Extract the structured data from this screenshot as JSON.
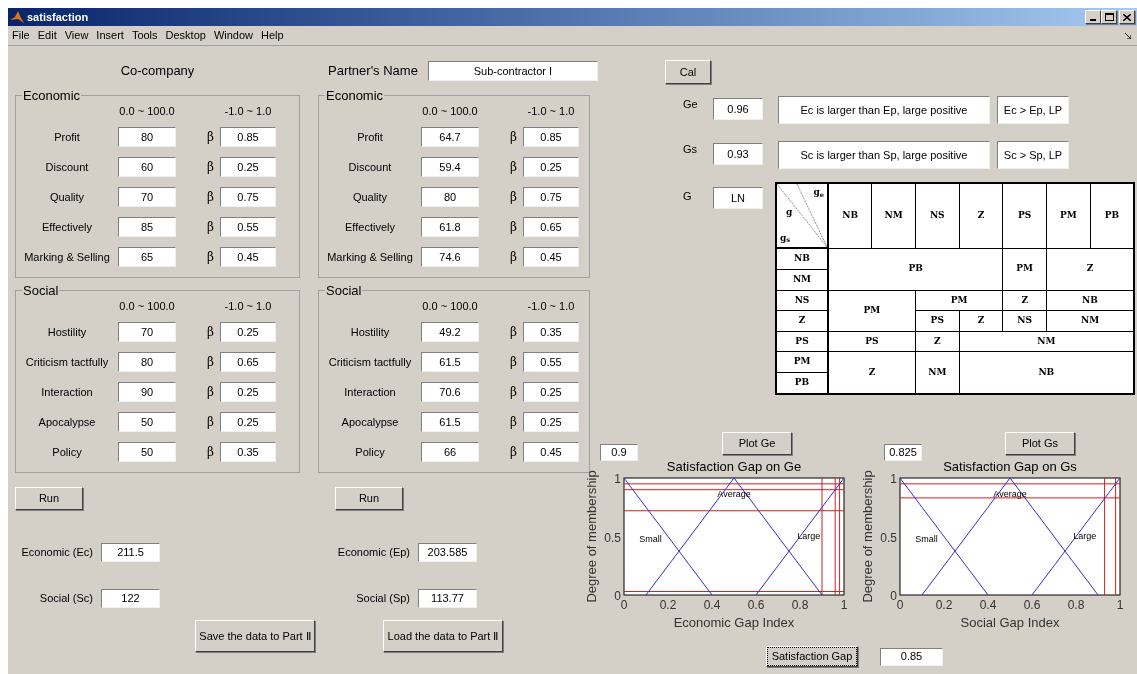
{
  "window": {
    "title": "satisfaction"
  },
  "menu": [
    "File",
    "Edit",
    "View",
    "Insert",
    "Tools",
    "Desktop",
    "Window",
    "Help"
  ],
  "companies": [
    {
      "kind": "heading",
      "title": "Co-company",
      "panels": [
        {
          "title": "Economic",
          "range_label": "0.0 ~ 100.0",
          "beta_range_label": "-1.0 ~ 1.0",
          "rows": [
            {
              "label": "Profit",
              "value": "80",
              "beta_symbol": "β",
              "beta": "0.85"
            },
            {
              "label": "Discount",
              "value": "60",
              "beta_symbol": "β",
              "beta": "0.25"
            },
            {
              "label": "Quality",
              "value": "70",
              "beta_symbol": "β",
              "beta": "0.75"
            },
            {
              "label": "Effectively",
              "value": "85",
              "beta_symbol": "β",
              "beta": "0.55"
            },
            {
              "label": "Marking & Selling",
              "value": "65",
              "beta_symbol": "β",
              "beta": "0.45"
            }
          ]
        },
        {
          "title": "Social",
          "range_label": "0.0 ~ 100.0",
          "beta_range_label": "-1.0 ~ 1.0",
          "rows": [
            {
              "label": "Hostility",
              "value": "70",
              "beta_symbol": "β",
              "beta": "0.25"
            },
            {
              "label": "Criticism tactfully",
              "value": "80",
              "beta_symbol": "β",
              "beta": "0.65"
            },
            {
              "label": "Interaction",
              "value": "90",
              "beta_symbol": "β",
              "beta": "0.25"
            },
            {
              "label": "Apocalypse",
              "value": "50",
              "beta_symbol": "β",
              "beta": "0.25"
            },
            {
              "label": "Policy",
              "value": "50",
              "beta_symbol": "β",
              "beta": "0.35"
            }
          ]
        }
      ],
      "run_button": "Run",
      "totals": [
        {
          "label": "Economic (Ec)",
          "value": "211.5"
        },
        {
          "label": "Social (Sc)",
          "value": "122"
        }
      ],
      "transfer_button": "Save the data to Part Ⅱ"
    },
    {
      "kind": "named",
      "label": "Partner's Name",
      "value": "Sub-contractor I",
      "panels": [
        {
          "title": "Economic",
          "range_label": "0.0 ~ 100.0",
          "beta_range_label": "-1.0 ~ 1.0",
          "rows": [
            {
              "label": "Profit",
              "value": "64.7",
              "beta_symbol": "β",
              "beta": "0.85"
            },
            {
              "label": "Discount",
              "value": "59.4",
              "beta_symbol": "β",
              "beta": "0.25"
            },
            {
              "label": "Quality",
              "value": "80",
              "beta_symbol": "β",
              "beta": "0.75"
            },
            {
              "label": "Effectively",
              "value": "61.8",
              "beta_symbol": "β",
              "beta": "0.65"
            },
            {
              "label": "Marking & Selling",
              "value": "74.6",
              "beta_symbol": "β",
              "beta": "0.45"
            }
          ]
        },
        {
          "title": "Social",
          "range_label": "0.0 ~ 100.0",
          "beta_range_label": "-1.0 ~ 1.0",
          "rows": [
            {
              "label": "Hostility",
              "value": "49.2",
              "beta_symbol": "β",
              "beta": "0.35"
            },
            {
              "label": "Criticism tactfully",
              "value": "61.5",
              "beta_symbol": "β",
              "beta": "0.55"
            },
            {
              "label": "Interaction",
              "value": "70.6",
              "beta_symbol": "β",
              "beta": "0.25"
            },
            {
              "label": "Apocalypse",
              "value": "61.5",
              "beta_symbol": "β",
              "beta": "0.25"
            },
            {
              "label": "Policy",
              "value": "66",
              "beta_symbol": "β",
              "beta": "0.45"
            }
          ]
        }
      ],
      "run_button": "Run",
      "totals": [
        {
          "label": "Economic (Ep)",
          "value": "203.585"
        },
        {
          "label": "Social (Sp)",
          "value": "113.77"
        }
      ],
      "transfer_button": "Load the data to Part Ⅱ"
    }
  ],
  "calculate_button": "Cal",
  "gaps": [
    {
      "label": "Ge",
      "value": "0.96",
      "description": "Ec is larger than Ep, large positive",
      "code": "Ec > Ep, LP"
    },
    {
      "label": "Gs",
      "value": "0.93",
      "description": "Sc is larger than Sp, large positive",
      "code": "Sc > Sp, LP"
    }
  ],
  "overall": {
    "label": "G",
    "value": "LN"
  },
  "rule_table": {
    "corner": {
      "top": "g$_{e}$",
      "middle": "g",
      "bottom": "g$_{s}$"
    },
    "columns": [
      "NB",
      "NM",
      "NS",
      "Z",
      "PS",
      "PM",
      "PB"
    ],
    "rows": [
      {
        "header": "NB",
        "cells": [
          {
            "text": "PB",
            "colspan": 4,
            "rowspan": 2
          },
          {
            "text": "PM",
            "rowspan": 2
          },
          {
            "text": "Z",
            "colspan": 2,
            "rowspan": 2
          }
        ]
      },
      {
        "header": "NM",
        "cells": []
      },
      {
        "header": "NS",
        "cells": [
          {
            "text": "PM",
            "colspan": 2,
            "rowspan": 2
          },
          {
            "text": "PM",
            "colspan": 2
          },
          {
            "text": "Z"
          },
          {
            "text": "NB",
            "colspan": 2
          }
        ]
      },
      {
        "header": "Z",
        "cells": [
          {
            "text": "PS"
          },
          {
            "text": "Z"
          },
          {
            "text": "NS"
          },
          {
            "text": "NM",
            "colspan": 2
          }
        ]
      },
      {
        "header": "PS",
        "cells": [
          {
            "text": "PS",
            "colspan": 2
          },
          {
            "text": "Z"
          },
          {
            "text": "NM",
            "colspan": 4
          }
        ]
      },
      {
        "header": "PM",
        "cells": [
          {
            "text": "Z",
            "colspan": 2,
            "rowspan": 2
          },
          {
            "text": "NM",
            "rowspan": 2
          },
          {
            "text": "NB",
            "colspan": 4,
            "rowspan": 2
          }
        ]
      },
      {
        "header": "PB",
        "cells": []
      }
    ]
  },
  "plots": [
    {
      "value": "0.9",
      "button": "Plot Ge",
      "chart_data": {
        "type": "line",
        "title": "Satisfaction Gap on Ge",
        "xlabel": "Economic Gap Index",
        "ylabel": "Degree of membership",
        "x": [
          0,
          0.1,
          0.4,
          0.5,
          0.6,
          0.9,
          1
        ],
        "series": [
          {
            "name": "Small",
            "color": "#3030c0",
            "values": [
              1,
              0.75,
              0,
              null,
              null,
              null,
              null
            ]
          },
          {
            "name": "Average",
            "color": "#3030c0",
            "values": [
              null,
              0,
              0.75,
              1,
              0.75,
              0,
              null
            ]
          },
          {
            "name": "Large",
            "color": "#3030c0",
            "values": [
              null,
              null,
              null,
              null,
              0,
              0.75,
              1
            ]
          }
        ],
        "xlim": [
          0,
          1
        ],
        "ylim": [
          0,
          1
        ],
        "xticks": [
          0,
          0.2,
          0.4,
          0.6,
          0.8,
          1
        ],
        "yticks": [
          0,
          0.5,
          1
        ],
        "ref_lines": [
          {
            "axis": "y",
            "value": 0.95
          },
          {
            "axis": "y",
            "value": 0.9
          },
          {
            "axis": "y",
            "value": 0.72
          },
          {
            "axis": "y",
            "value": 0.03
          },
          {
            "axis": "x",
            "value": 0.98
          },
          {
            "axis": "x",
            "value": 0.96
          },
          {
            "axis": "x",
            "value": 0.9
          }
        ]
      }
    },
    {
      "value": "0.825",
      "button": "Plot Gs",
      "chart_data": {
        "type": "line",
        "title": "Satisfaction Gap on Gs",
        "xlabel": "Social Gap Index",
        "ylabel": "Degree of membership",
        "x": [
          0,
          0.1,
          0.4,
          0.5,
          0.6,
          0.9,
          1
        ],
        "series": [
          {
            "name": "Small",
            "color": "#3030c0",
            "values": [
              1,
              0.75,
              0,
              null,
              null,
              null,
              null
            ]
          },
          {
            "name": "Average",
            "color": "#3030c0",
            "values": [
              null,
              0,
              0.75,
              1,
              0.75,
              0,
              null
            ]
          },
          {
            "name": "Large",
            "color": "#3030c0",
            "values": [
              null,
              null,
              null,
              null,
              0,
              0.75,
              1
            ]
          }
        ],
        "xlim": [
          0,
          1
        ],
        "ylim": [
          0,
          1
        ],
        "xticks": [
          0,
          0.2,
          0.4,
          0.6,
          0.8,
          1
        ],
        "yticks": [
          0,
          0.5,
          1
        ],
        "ref_lines": [
          {
            "axis": "y",
            "value": 0.95
          },
          {
            "axis": "y",
            "value": 0.83
          },
          {
            "axis": "x",
            "value": 0.98
          },
          {
            "axis": "x",
            "value": 0.93
          }
        ]
      }
    }
  ],
  "satisfaction_gap": {
    "button": "Satisfaction Gap",
    "value": "0.85"
  }
}
